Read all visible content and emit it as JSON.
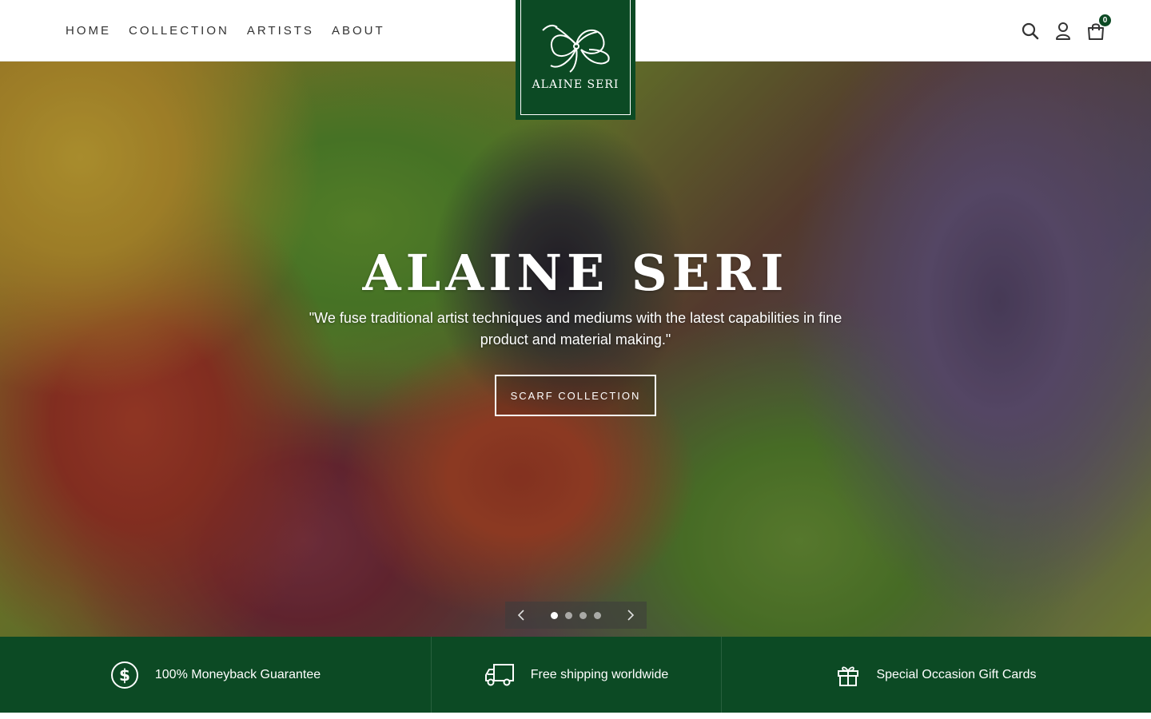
{
  "nav": {
    "items": [
      {
        "label": "HOME"
      },
      {
        "label": "COLLECTION"
      },
      {
        "label": "ARTISTS"
      },
      {
        "label": "ABOUT"
      }
    ]
  },
  "logo": {
    "brand": "ALAINE SERI",
    "icon": "hibiscus-flower-logo",
    "background": "#0c4a24"
  },
  "header_icons": {
    "search": "search-icon",
    "account": "user-icon",
    "cart": "shopping-bag-icon",
    "cart_count": "0"
  },
  "hero": {
    "title": "ALAINE SERI",
    "quote": "\"We fuse traditional artist techniques and mediums with the latest capabilities in fine product and material making.\"",
    "button_label": "SCARF COLLECTION",
    "slides_total": 4,
    "active_slide": 1
  },
  "features": [
    {
      "icon": "dollar-circle-icon",
      "label": "100% Moneyback Guarantee"
    },
    {
      "icon": "truck-icon",
      "label": "Free shipping worldwide"
    },
    {
      "icon": "gift-icon",
      "label": "Special Occasion Gift Cards"
    }
  ],
  "colors": {
    "brand_green": "#0c4a24",
    "text_dark": "#333333",
    "white": "#ffffff"
  }
}
